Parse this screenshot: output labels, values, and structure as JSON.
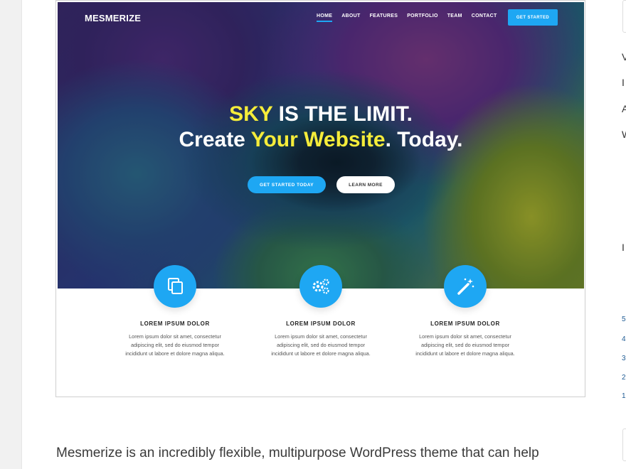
{
  "theme": {
    "logo": "MESMERIZE",
    "nav": [
      "HOME",
      "ABOUT",
      "FEATURES",
      "PORTFOLIO",
      "TEAM",
      "CONTACT"
    ],
    "nav_cta": "GET STARTED",
    "headline": {
      "line1_highlight": "SKY",
      "line1_rest": " IS THE LIMIT.",
      "line2_start": "Create ",
      "line2_highlight": "Your Website",
      "line2_end": ". Today."
    },
    "buttons": {
      "primary": "GET STARTED TODAY",
      "secondary": "LEARN MORE"
    },
    "features": [
      {
        "icon": "copy-icon",
        "title": "LOREM IPSUM DOLOR",
        "line1": "Lorem ipsum dolor sit amet, consectetur",
        "line2": "adipiscing elit, sed do eiusmod tempor",
        "line3": "incididunt ut labore et dolore magna aliqua."
      },
      {
        "icon": "gears-icon",
        "title": "LOREM IPSUM DOLOR",
        "line1": "Lorem ipsum dolor sit amet, consectetur",
        "line2": "adipiscing elit, sed do eiusmod tempor",
        "line3": "incididunt ut labore et dolore magna aliqua."
      },
      {
        "icon": "magic-wand-icon",
        "title": "LOREM IPSUM DOLOR",
        "line1": "Lorem ipsum dolor sit amet, consectetur",
        "line2": "adipiscing elit, sed do eiusmod tempor",
        "line3": "incididunt ut labore et dolore magna aliqua."
      }
    ],
    "colors": {
      "accent": "#1ea7f3",
      "highlight": "#f5ec3a"
    }
  },
  "article": {
    "text": "Mesmerize is an incredibly flexible, multipurpose WordPress theme that can help"
  },
  "sidebar_fragments": {
    "letters": [
      "V",
      "I",
      "A",
      "W",
      "I"
    ],
    "digits": [
      "5",
      "4",
      "3",
      "2",
      "1"
    ]
  }
}
